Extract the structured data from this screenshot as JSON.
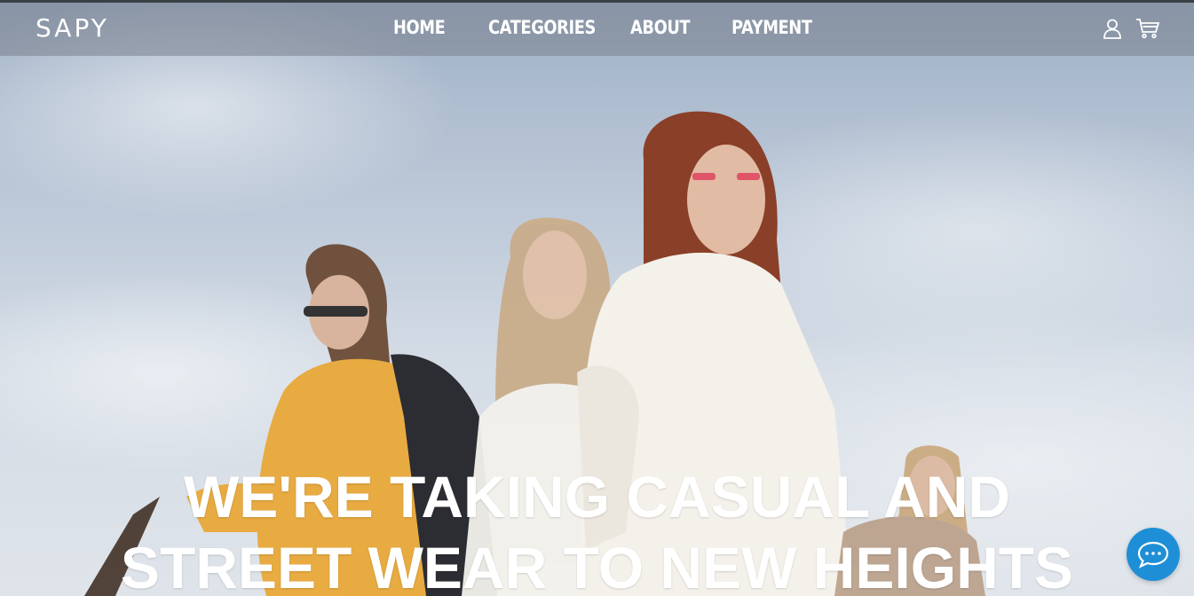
{
  "header": {
    "logo": "SAPY",
    "nav": [
      "HOME",
      "CATEGORIES",
      "ABOUT",
      "PAYMENT"
    ]
  },
  "icons": {
    "account": "user-icon",
    "cart": "cart-icon",
    "chat": "chat-bubble-icon"
  },
  "hero": {
    "headline_line1": "WE'RE TAKING CASUAL AND",
    "headline_line2": "STREET WEAR TO NEW HEIGHTS"
  },
  "colors": {
    "nav_text": "#ffffff",
    "headline": "#ffffff",
    "chat_button": "#1e8fd6"
  }
}
